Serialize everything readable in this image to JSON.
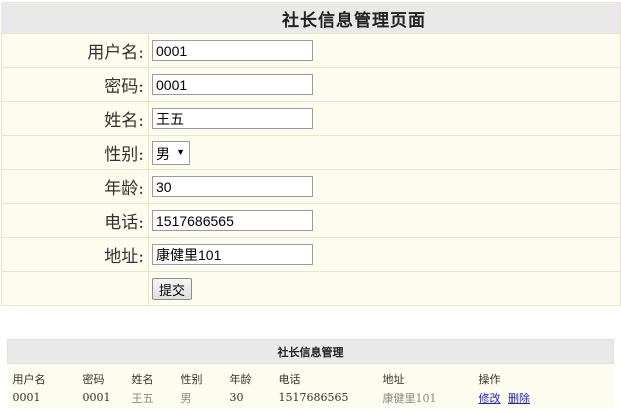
{
  "form": {
    "title": "社长信息管理页面",
    "fields": {
      "username": {
        "label": "用户名:",
        "value": "0001"
      },
      "password": {
        "label": "密码:",
        "value": "0001"
      },
      "name": {
        "label": "姓名:",
        "value": "王五"
      },
      "gender": {
        "label": "性别:",
        "value": "男"
      },
      "age": {
        "label": "年龄:",
        "value": "30"
      },
      "phone": {
        "label": "电话:",
        "value": "1517686565"
      },
      "address": {
        "label": "地址:",
        "value": "康健里101"
      }
    },
    "submit_label": "提交"
  },
  "list": {
    "title": "社长信息管理",
    "columns": [
      "用户名",
      "密码",
      "姓名",
      "性别",
      "年龄",
      "电话",
      "地址",
      "操作"
    ],
    "rows": [
      {
        "username": "0001",
        "password": "0001",
        "name": "王五",
        "gender": "男",
        "age": "30",
        "phone": "1517686565",
        "address": "康健里101",
        "edit_label": "修改",
        "delete_label": "删除"
      }
    ]
  },
  "colors": {
    "title_bar": "#e9e9e9",
    "row_background": "#fcfcef",
    "border": "#e8e6cf",
    "link": "#2222cc"
  },
  "icons": {
    "gender_select_caret": "caret-down-icon"
  }
}
